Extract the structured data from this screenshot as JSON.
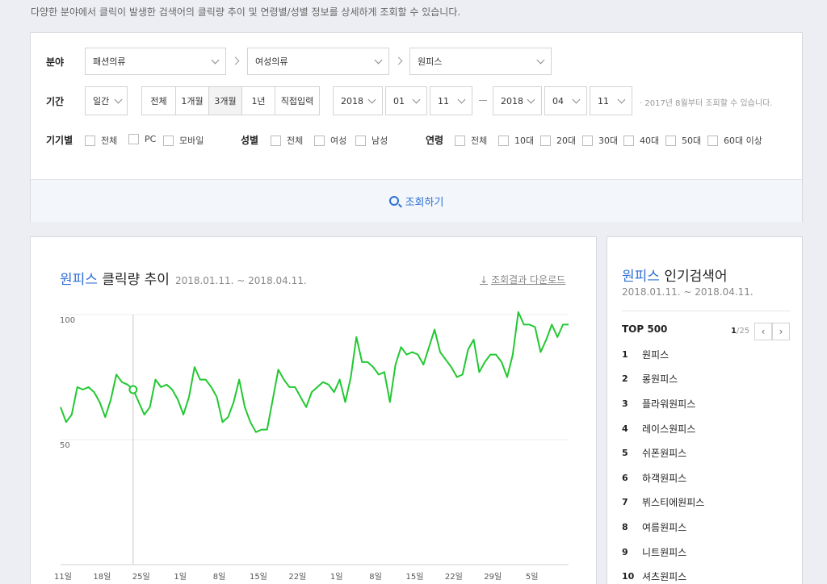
{
  "description": "다양한 분야에서 클릭이 발생한 검색어의 클릭량 추이 및 연령별/성별 정보를 상세하게 조회할 수 있습니다.",
  "filter": {
    "field_label": "분야",
    "category1": "패션의류",
    "category2": "여성의류",
    "category3": "원피스",
    "period_label": "기간",
    "unit": "일간",
    "period_buttons": [
      "전체",
      "1개월",
      "3개월",
      "1년",
      "직접입력"
    ],
    "active_period": "3개월",
    "start_year": "2018",
    "start_month": "01",
    "start_day": "11",
    "end_year": "2018",
    "end_month": "04",
    "end_day": "11",
    "note": "· 2017년 8월부터 조회할 수 있습니다.",
    "device_label": "기기별",
    "device_options": [
      "전체",
      "PC",
      "모바일"
    ],
    "gender_label": "성별",
    "gender_options": [
      "전체",
      "여성",
      "남성"
    ],
    "age_label": "연령",
    "age_options": [
      "전체",
      "10대",
      "20대",
      "30대",
      "40대",
      "50대",
      "60대 이상"
    ],
    "search_button": "조회하기"
  },
  "chart": {
    "keyword": "원피스",
    "title_suffix": " 클릭량 추이",
    "date_range": "2018.01.11. ~ 2018.04.11.",
    "download_label": "조회결과 다운로드"
  },
  "chart_data": {
    "type": "line",
    "ylim": [
      0,
      100
    ],
    "yticks": [
      100,
      50
    ],
    "x_tick_labels": [
      "11일",
      "18일",
      "25일",
      "1일",
      "8일",
      "15일",
      "22일",
      "1일",
      "8일",
      "15일",
      "22일",
      "29일",
      "5일"
    ],
    "x_tick_index": [
      0,
      7,
      14,
      21,
      28,
      35,
      42,
      49,
      56,
      63,
      70,
      77,
      84
    ],
    "highlight_index": 13,
    "series": [
      {
        "color": "#22c832",
        "values": [
          63,
          57,
          60,
          71,
          70,
          71,
          69,
          65,
          59,
          66,
          76,
          73,
          72,
          70,
          65,
          60,
          63,
          74,
          71,
          72,
          70,
          66,
          60,
          67,
          79,
          74,
          74,
          71,
          67,
          57,
          59,
          65,
          74,
          63,
          57,
          53,
          54,
          54,
          66,
          78,
          74,
          71,
          71,
          67,
          63,
          69,
          71,
          73,
          72,
          69,
          74,
          65,
          75,
          91,
          81,
          81,
          79,
          76,
          77,
          65,
          80,
          87,
          84,
          85,
          84,
          80,
          87,
          94,
          85,
          82,
          79,
          75,
          76,
          86,
          90,
          77,
          81,
          84,
          84,
          81,
          75,
          84,
          101,
          96,
          96,
          95,
          85,
          90,
          96,
          91,
          96,
          96
        ]
      }
    ]
  },
  "popular": {
    "keyword": "원피스",
    "title_suffix": " 인기검색어",
    "date_range": "2018.01.11. ~ 2018.04.11.",
    "top_label": "TOP 500",
    "page_current": "1",
    "page_total": "/25",
    "prev_icon": "‹",
    "next_icon": "›",
    "items": [
      {
        "rank": "1",
        "term": "원피스"
      },
      {
        "rank": "2",
        "term": "롱원피스"
      },
      {
        "rank": "3",
        "term": "플라워원피스"
      },
      {
        "rank": "4",
        "term": "레이스원피스"
      },
      {
        "rank": "5",
        "term": "쉬폰원피스"
      },
      {
        "rank": "6",
        "term": "하객원피스"
      },
      {
        "rank": "7",
        "term": "뷔스티에원피스"
      },
      {
        "rank": "8",
        "term": "여름원피스"
      },
      {
        "rank": "9",
        "term": "니트원피스"
      },
      {
        "rank": "10",
        "term": "셔츠원피스"
      }
    ]
  }
}
